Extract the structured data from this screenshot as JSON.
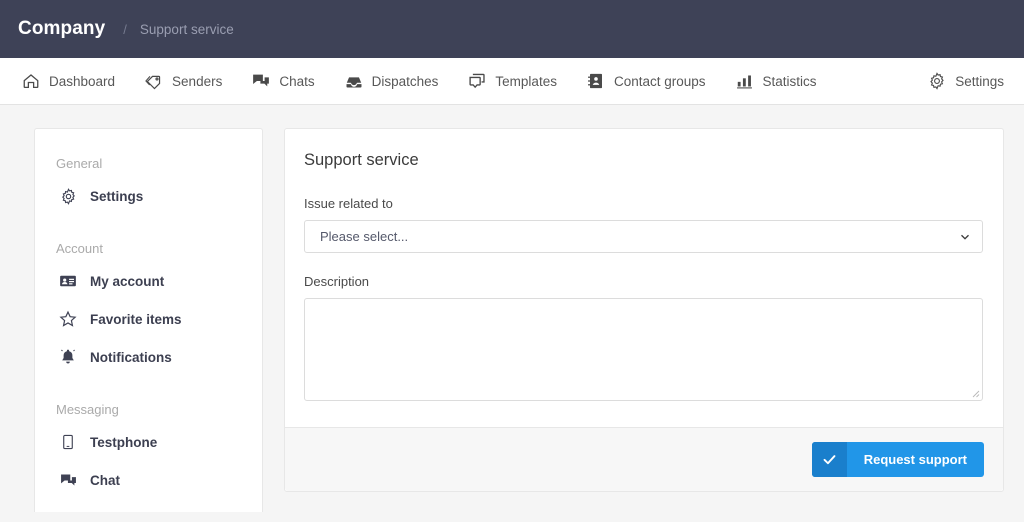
{
  "header": {
    "brand": "Company",
    "separator": "/",
    "breadcrumb": "Support service",
    "bg_color": "#3e4257"
  },
  "nav": {
    "items": [
      {
        "label": "Dashboard",
        "icon": "home-icon"
      },
      {
        "label": "Senders",
        "icon": "tag-icon"
      },
      {
        "label": "Chats",
        "icon": "chats-icon"
      },
      {
        "label": "Dispatches",
        "icon": "inbox-icon"
      },
      {
        "label": "Templates",
        "icon": "template-icon"
      },
      {
        "label": "Contact groups",
        "icon": "contact-book-icon"
      },
      {
        "label": "Statistics",
        "icon": "bar-chart-icon"
      }
    ],
    "right": {
      "label": "Settings",
      "icon": "gear-icon"
    }
  },
  "sidebar": {
    "groups": [
      {
        "title": "General",
        "items": [
          {
            "label": "Settings",
            "icon": "gear-icon"
          }
        ]
      },
      {
        "title": "Account",
        "items": [
          {
            "label": "My account",
            "icon": "id-card-icon"
          },
          {
            "label": "Favorite items",
            "icon": "star-icon"
          },
          {
            "label": "Notifications",
            "icon": "bell-icon"
          }
        ]
      },
      {
        "title": "Messaging",
        "items": [
          {
            "label": "Testphone",
            "icon": "phone-icon"
          },
          {
            "label": "Chat",
            "icon": "chats-icon"
          }
        ]
      }
    ]
  },
  "main": {
    "title": "Support service",
    "issue_label": "Issue related to",
    "issue_value": "Please select...",
    "issue_options": [
      "Please select..."
    ],
    "description_label": "Description",
    "description_value": "",
    "description_placeholder": "",
    "submit_label": "Request support",
    "submit_icon": "check-icon",
    "accent_color": "#2196e8",
    "accent_dark_color": "#1a7fcc"
  }
}
